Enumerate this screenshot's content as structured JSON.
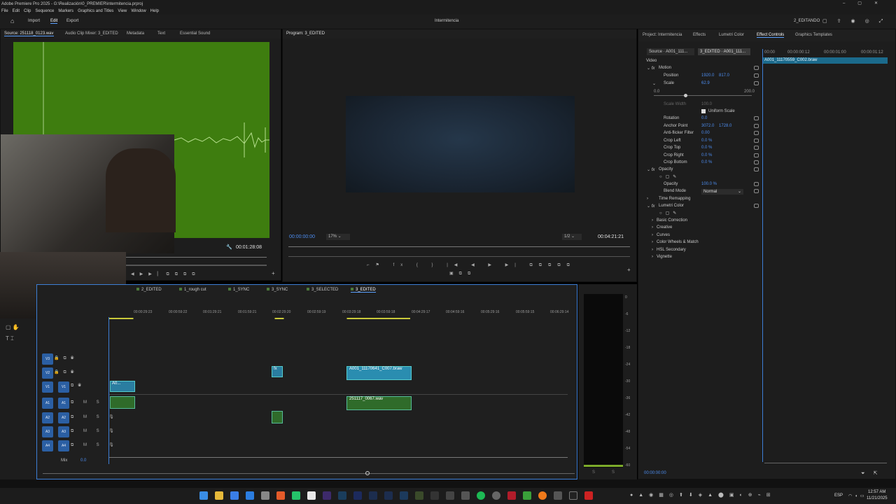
{
  "window": {
    "title": "Adobe Premiere Pro 2025 - G:\\Realización\\0_PREMIER\\intermitencia.prproj"
  },
  "menu": [
    "File",
    "Edit",
    "Clip",
    "Sequence",
    "Markers",
    "Graphics and Titles",
    "View",
    "Window",
    "Help"
  ],
  "workspace": {
    "tabs": [
      "Import",
      "Edit",
      "Export"
    ],
    "center": "Intermitencia",
    "right": "2_EDITANDO"
  },
  "source": {
    "tabs": [
      "Source: 251118_0123.wav",
      "Audio Clip Mixer: 3_EDITED",
      "Metadata",
      "Text",
      "Essential Sound"
    ],
    "timecode": "00:01:28:08"
  },
  "program": {
    "title": "Program: 3_EDITED",
    "timecode": "00:00:00:00",
    "zoom": "17%",
    "resolution": "1/2",
    "duration": "00:04:21:21"
  },
  "right_tabs": [
    "Project: Intermitencia",
    "Effects",
    "Lumetri Color",
    "Effect Controls",
    "Graphics Templates"
  ],
  "effect_controls": {
    "source": "Source · A001_111...",
    "seq": "3_EDITED · A001_111...",
    "ruler": [
      "00:00",
      "00:00:00:12",
      "00:00:01:00",
      "00:00:01:12"
    ],
    "clip_name": "A001_11170559_C002.braw",
    "video": "Video",
    "motion": "Motion",
    "position_label": "Position",
    "position_x": "1920.0",
    "position_y": "817.0",
    "scale_label": "Scale",
    "scale": "62.9",
    "scale_min": "0.0",
    "scale_max": "200.0",
    "scale_width_label": "Scale Width",
    "scale_width": "100.0",
    "uniform_scale": "Uniform Scale",
    "rotation_label": "Rotation",
    "rotation": "0.0",
    "anchor_label": "Anchor Point",
    "anchor_x": "3072.0",
    "anchor_y": "1728.0",
    "antiflicker_label": "Anti-flicker Filter",
    "antiflicker": "0.00",
    "crop_left_label": "Crop Left",
    "crop_left": "0.0 %",
    "crop_top_label": "Crop Top",
    "crop_top": "0.0 %",
    "crop_right_label": "Crop Right",
    "crop_right": "0.0 %",
    "crop_bottom_label": "Crop Bottom",
    "crop_bottom": "0.0 %",
    "opacity_group": "Opacity",
    "opacity_label": "Opacity",
    "opacity": "100.0 %",
    "blend_label": "Blend Mode",
    "blend": "Normal",
    "time_remap": "Time Remapping",
    "lumetri": "Lumetri Color",
    "lumetri_items": [
      "Basic Correction",
      "Creative",
      "Curves",
      "Color Wheels & Match",
      "HSL Secondary",
      "Vignette"
    ],
    "footer_tc": "00:00:00:00"
  },
  "timeline": {
    "tabs": [
      "2_EDITED",
      "1_rough cut",
      "1_SYNC",
      "3_SYNC",
      "3_SELECTED",
      "3_EDITED"
    ],
    "ruler": [
      "00:00:29:23",
      "00:00:59:22",
      "00:01:29:21",
      "00:01:59:21",
      "00:02:29:20",
      "00:02:59:19",
      "00:03:29:18",
      "00:03:59:18",
      "00:04:29:17",
      "00:04:59:16",
      "00:05:29:16",
      "00:05:59:15",
      "00:06:29:14"
    ],
    "video_tracks": [
      "V3",
      "V2",
      "V1"
    ],
    "audio_tracks": [
      "A1",
      "A2",
      "A3",
      "A4"
    ],
    "mix": "Mix",
    "mix_val": "0.0",
    "clip_v2": "A001_11170641_C007.braw",
    "clip_v1a": "A0...",
    "clip_v1b": "fx",
    "clip_v2s": "fx",
    "clip_a1": "251117_0067.wav"
  },
  "meter": {
    "scale": [
      "0",
      "-6",
      "-12",
      "-18",
      "-24",
      "-30",
      "-36",
      "-42",
      "-48",
      "-54",
      "-60"
    ],
    "footer": [
      "S",
      "S"
    ]
  },
  "taskbar": {
    "lang": "ESP",
    "time": "12:57 AM",
    "date": "11/21/2025"
  }
}
